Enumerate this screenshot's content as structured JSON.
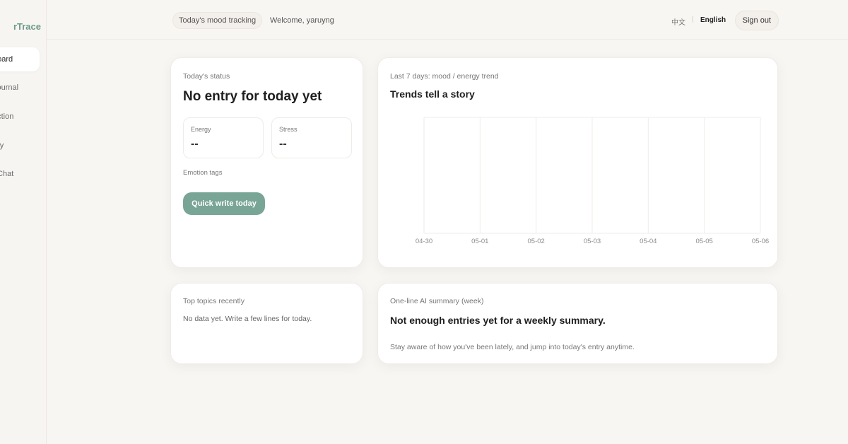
{
  "sidebar": {
    "brand": "rTrace",
    "items": [
      {
        "label": "board",
        "active": true
      },
      {
        "label": "Journal",
        "active": false
      },
      {
        "label": "ection",
        "active": false
      },
      {
        "label": "ory",
        "active": false
      },
      {
        "label": "t Chat",
        "active": false
      }
    ]
  },
  "topbar": {
    "mood_tracking": "Today's mood tracking",
    "welcome": "Welcome, yaruyng",
    "lang_zh": "中文",
    "lang_sep": "|",
    "lang_en": "English",
    "sign_out": "Sign out"
  },
  "status_card": {
    "label": "Today's status",
    "title": "No entry for today yet",
    "energy_label": "Energy",
    "energy_value": "--",
    "stress_label": "Stress",
    "stress_value": "--",
    "emotion_tags_label": "Emotion tags",
    "quick_write": "Quick write today"
  },
  "trend_card": {
    "label": "Last 7 days: mood / energy trend",
    "title": "Trends tell a story"
  },
  "chart_data": {
    "type": "line",
    "categories": [
      "04-30",
      "05-01",
      "05-02",
      "05-03",
      "05-04",
      "05-05",
      "05-06"
    ],
    "series": [],
    "grid": true
  },
  "topics_card": {
    "label": "Top topics recently",
    "text": "No data yet. Write a few lines for today."
  },
  "summary_card": {
    "label": "One-line AI summary (week)",
    "title": "Not enough entries yet for a weekly summary.",
    "text": "Stay aware of how you've been lately, and jump into today's entry anytime."
  },
  "colors": {
    "accent": "#78a596",
    "brand": "#6f9a8b",
    "background": "#f8f6f3"
  }
}
